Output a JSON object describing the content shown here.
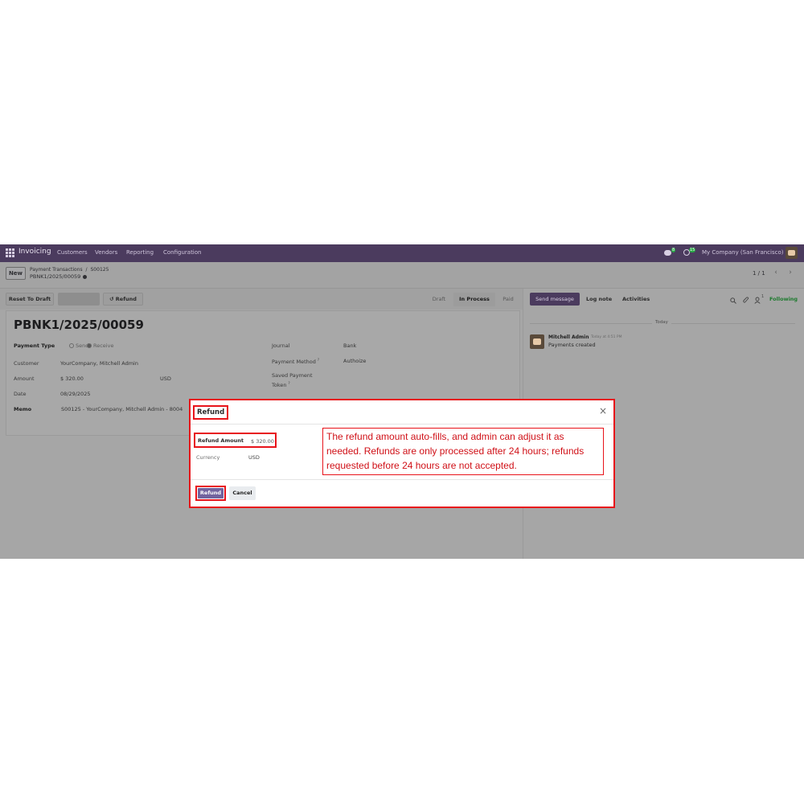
{
  "navbar": {
    "brand": "Invoicing",
    "menu": [
      "Customers",
      "Vendors",
      "Reporting",
      "Configuration"
    ],
    "chat_badge": "8",
    "activity_badge": "15",
    "company": "My Company (San Francisco)"
  },
  "control_panel": {
    "new_label": "New",
    "breadcrumb_parent": "Payment Transactions",
    "breadcrumb_sep": "/",
    "breadcrumb_ref": "S00125",
    "record_name": "PBNK1/2025/00059",
    "pager": "1 / 1"
  },
  "form": {
    "reset_label": "Reset To Draft",
    "refund_label": "Refund",
    "refund_icon_glyph": "↺",
    "statuses": [
      "Draft",
      "In Process",
      "Paid"
    ],
    "active_status": "In Process",
    "title": "PBNK1/2025/00059",
    "fields": {
      "payment_type_label": "Payment Type",
      "payment_type_send": "Send",
      "payment_type_receive": "Receive",
      "customer_label": "Customer",
      "customer_value": "YourCompany, Mitchell Admin",
      "amount_label": "Amount",
      "amount_value": "$ 320.00",
      "amount_currency": "USD",
      "date_label": "Date",
      "date_value": "08/29/2025",
      "memo_label": "Memo",
      "memo_value": "S00125 - YourCompany, Mitchell Admin - 8004",
      "journal_label": "Journal",
      "journal_value": "Bank",
      "payment_method_label": "Payment Method",
      "payment_method_value": "Authoize",
      "saved_token_label_1": "Saved Payment",
      "saved_token_label_2": "Token",
      "help_mark": "?"
    }
  },
  "chatter": {
    "send_message": "Send message",
    "log_note": "Log note",
    "activities": "Activities",
    "followers_count": "1",
    "following": "Following",
    "today": "Today",
    "author": "Mitchell Admin",
    "time": "Today at 4:51 PM",
    "message": "Payments created"
  },
  "modal": {
    "title": "Refund",
    "close_glyph": "×",
    "refund_amount_label": "Refund Amount",
    "refund_amount_value": "$ 320.00",
    "currency_label": "Currency",
    "currency_value": "USD",
    "note": "The refund amount auto-fills, and admin can adjust it as needed. Refunds are only processed after 24 hours; refunds requested before 24 hours are not accepted.",
    "refund_button": "Refund",
    "cancel_button": "Cancel"
  },
  "colors": {
    "navbar": "#4b3b5e",
    "primary": "#71639e",
    "annotation": "#e8131a",
    "badge": "#28a745"
  }
}
